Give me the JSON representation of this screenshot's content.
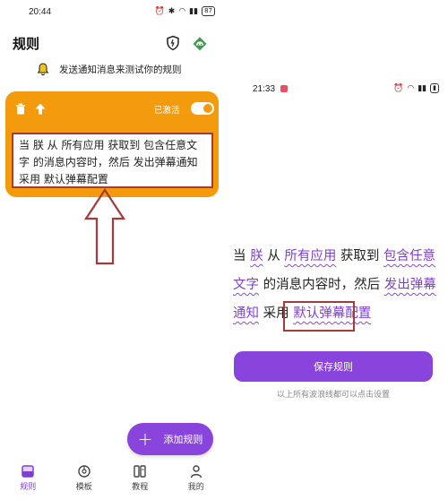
{
  "left": {
    "status": {
      "time": "20:44",
      "battery": "87"
    },
    "title": "规则",
    "banner": "发送通知消息来测试你的规则",
    "card": {
      "active_label": "已激活",
      "rule_text": "当 朕 从 所有应用 获取到 包含任意文字 的消息内容时，然后 发出弹幕通知 采用 默认弹幕配置"
    },
    "fab_label": "添加规则",
    "nav": [
      {
        "label": "规则",
        "icon": "rules-icon"
      },
      {
        "label": "模板",
        "icon": "template-icon"
      },
      {
        "label": "教程",
        "icon": "tutorial-icon"
      },
      {
        "label": "我的",
        "icon": "profile-icon"
      }
    ]
  },
  "right": {
    "status": {
      "time": "21:33"
    },
    "sentence": {
      "p1": "当 ",
      "h1": "朕",
      "p2": " 从 ",
      "h2": "所有应用",
      "p3": " 获取到 ",
      "h3": "包含任意文字",
      "p4": " 的消息内容时，然后 ",
      "h4": "发出弹幕通知",
      "p5": " 采用 ",
      "h5": "默认弹幕配置"
    },
    "save_label": "保存规则",
    "hint": "以上所有波浪线都可以点击设置"
  },
  "colors": {
    "accent": "#8a44de",
    "card": "#f49a0d",
    "frame": "#a43a3a"
  }
}
